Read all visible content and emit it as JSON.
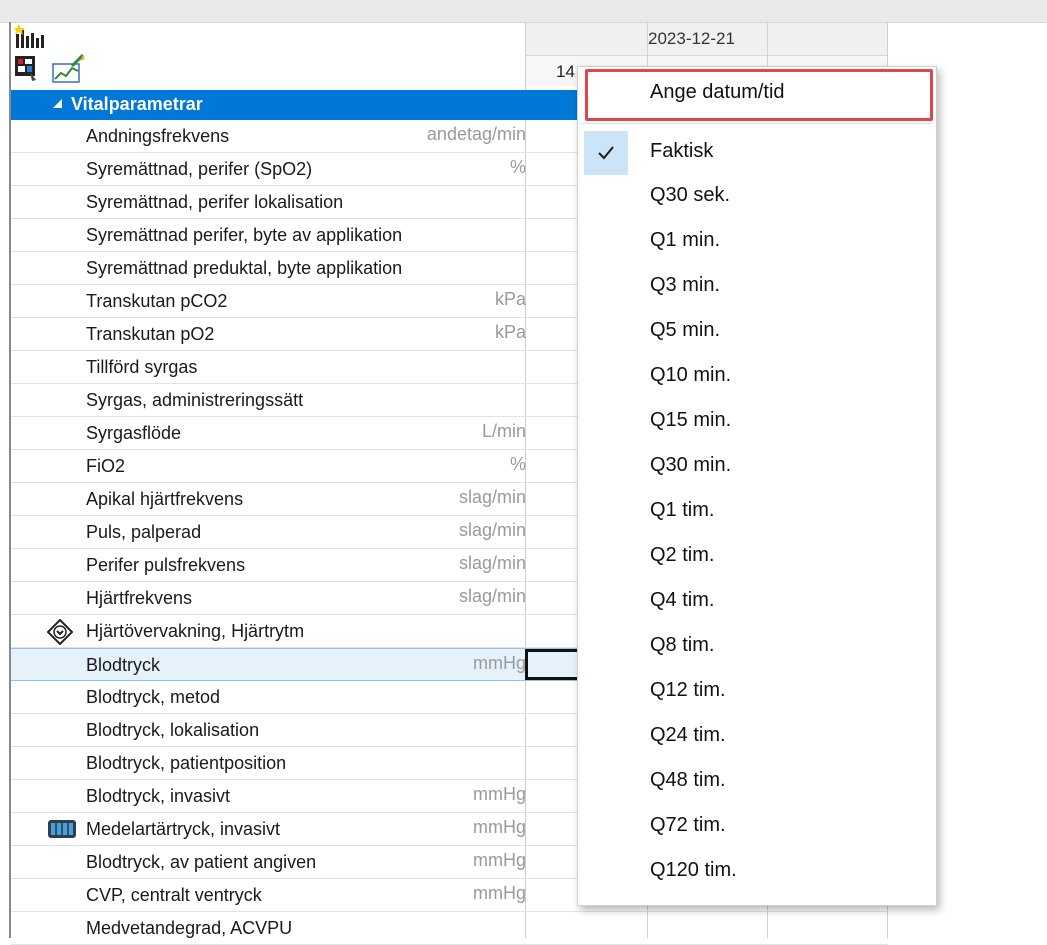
{
  "grid": {
    "date": "2023-12-21",
    "time_partial": "14"
  },
  "section": {
    "label": "Vitalparametrar"
  },
  "rows": [
    {
      "label": "Andningsfrekvens",
      "unit": "andetag/min"
    },
    {
      "label": "Syremättnad, perifer (SpO2)",
      "unit": "%"
    },
    {
      "label": "Syremättnad, perifer lokalisation",
      "unit": ""
    },
    {
      "label": "Syremättnad perifer, byte av applikation",
      "unit": ""
    },
    {
      "label": "Syremättnad preduktal, byte applikation",
      "unit": ""
    },
    {
      "label": "Transkutan pCO2",
      "unit": "kPa"
    },
    {
      "label": "Transkutan pO2",
      "unit": "kPa"
    },
    {
      "label": "Tillförd syrgas",
      "unit": ""
    },
    {
      "label": "Syrgas, administreringssätt",
      "unit": ""
    },
    {
      "label": "Syrgasflöde",
      "unit": "L/min"
    },
    {
      "label": "FiO2",
      "unit": "%"
    },
    {
      "label": "Apikal hjärtfrekvens",
      "unit": "slag/min"
    },
    {
      "label": "Puls, palperad",
      "unit": "slag/min"
    },
    {
      "label": "Perifer pulsfrekvens",
      "unit": "slag/min"
    },
    {
      "label": "Hjärtfrekvens",
      "unit": "slag/min"
    },
    {
      "label": "Hjärtövervakning, Hjärtrytm",
      "unit": ""
    },
    {
      "label": "Blodtryck",
      "unit": "mmHg"
    },
    {
      "label": "Blodtryck, metod",
      "unit": ""
    },
    {
      "label": "Blodtryck, lokalisation",
      "unit": ""
    },
    {
      "label": "Blodtryck, patientposition",
      "unit": ""
    },
    {
      "label": "Blodtryck, invasivt",
      "unit": "mmHg"
    },
    {
      "label": "Medelartärtryck, invasivt",
      "unit": "mmHg"
    },
    {
      "label": "Blodtryck, av patient angiven",
      "unit": "mmHg"
    },
    {
      "label": "CVP, centralt ventryck",
      "unit": "mmHg"
    },
    {
      "label": "Medvetandegrad, ACVPU",
      "unit": ""
    }
  ],
  "menu": {
    "first_item": "Ange datum/tid",
    "items": [
      {
        "label": "Faktisk",
        "checked": true
      },
      {
        "label": "Q30 sek."
      },
      {
        "label": "Q1 min."
      },
      {
        "label": "Q3 min."
      },
      {
        "label": "Q5 min."
      },
      {
        "label": "Q10 min."
      },
      {
        "label": "Q15 min."
      },
      {
        "label": "Q30 min."
      },
      {
        "label": "Q1 tim."
      },
      {
        "label": "Q2 tim."
      },
      {
        "label": "Q4 tim."
      },
      {
        "label": "Q8 tim."
      },
      {
        "label": "Q12 tim."
      },
      {
        "label": "Q24 tim."
      },
      {
        "label": "Q48 tim."
      },
      {
        "label": "Q72 tim."
      },
      {
        "label": "Q120 tim."
      }
    ]
  },
  "colors": {
    "section_bg": "#0078d7",
    "selected_row_bg": "#e6f2fb",
    "check_bg": "#cce4f7",
    "highlight_border": "#e0454a"
  }
}
